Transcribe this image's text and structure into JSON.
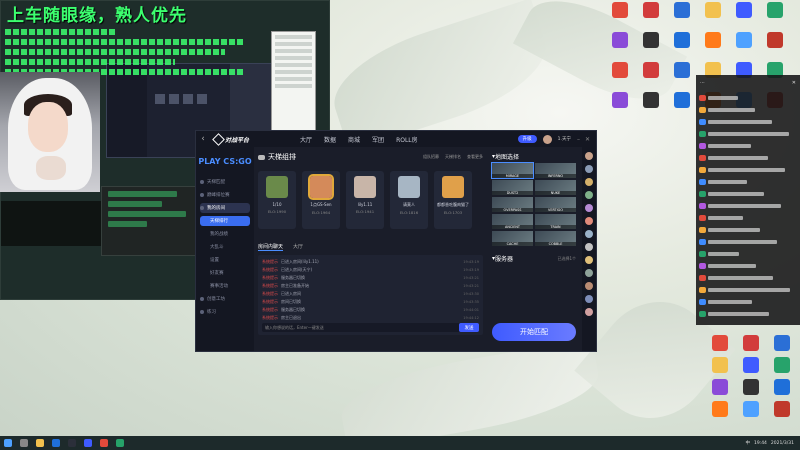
{
  "overlay": {
    "caption": "上车随眼缘，熟人优先"
  },
  "platform": {
    "game_label": "PLAY CS:GO",
    "logo_text": "对战平台",
    "nav": [
      "大厅",
      "数据",
      "商城",
      "军团",
      "ROLL房"
    ],
    "top_badge": "升级",
    "user_name": "1.天宁",
    "sidebar": [
      "天梯匹配",
      "巅峰排位赛",
      "我的房间",
      "天梯排行",
      "设置",
      "我的战绩",
      "好友赛",
      "赛事活动",
      "创意工坊",
      "练习"
    ],
    "sidebar_active_index": 0,
    "sidebar_sub": [
      "天梯排行",
      "我的战绩",
      "大乱斗"
    ],
    "ladder": {
      "title": "天梯组排",
      "links": [
        "组队招募",
        "天梯排名",
        "查看更多"
      ],
      "cards": [
        {
          "name": "1/10",
          "elo": "ELO:1990"
        },
        {
          "name": "1点GS-Sen",
          "elo": "ELO:1964"
        },
        {
          "name": "lily1.11",
          "elo": "ELO:1941"
        },
        {
          "name": "请莫人",
          "elo": "ELO:1816"
        },
        {
          "name": "都都香吃腹肉猫了",
          "elo": "ELO:1703"
        }
      ]
    },
    "chat": {
      "tabs": [
        "房间内聊天",
        "大厅"
      ],
      "lines": [
        {
          "user": "系统提示",
          "text": "已进入房间(lily1.11)",
          "time": "19:43:19"
        },
        {
          "user": "系统提示",
          "text": "已进入房间(天宁)",
          "time": "19:43:19"
        },
        {
          "user": "系统提示",
          "text": "服务器已切换",
          "time": "19:43:21"
        },
        {
          "user": "系统提示",
          "text": "房主已准备开始",
          "time": "19:43:21"
        },
        {
          "user": "系统提示",
          "text": "已进入房间",
          "time": "19:43:30"
        },
        {
          "user": "系统提示",
          "text": "房间已切换",
          "time": "19:43:35"
        },
        {
          "user": "系统提示",
          "text": "服务器已切换",
          "time": "19:44:01"
        },
        {
          "user": "系统提示",
          "text": "房主已退出",
          "time": "19:44:12"
        }
      ],
      "input_placeholder": "输入你想说的话，Enter一键发送",
      "send": "发送"
    },
    "maps": {
      "title": "地图选择",
      "list": [
        "MIRAGE",
        "INFERNO",
        "DUST2",
        "NUKE",
        "OVERPASS",
        "VERTIGO",
        "ANCIENT",
        "TRAIN",
        "CACHE",
        "COBBLE"
      ],
      "selected_index": 0
    },
    "server": {
      "title": "服务器",
      "value": "已选择1个"
    },
    "match_button": "开始匹配"
  },
  "taskbar": {
    "time": "19:44",
    "date": "2021/3/31",
    "ime": "中"
  },
  "colors": {
    "accent": "#3f5bff",
    "caption": "#3cff6f",
    "window_bg": "#1a1d29"
  }
}
